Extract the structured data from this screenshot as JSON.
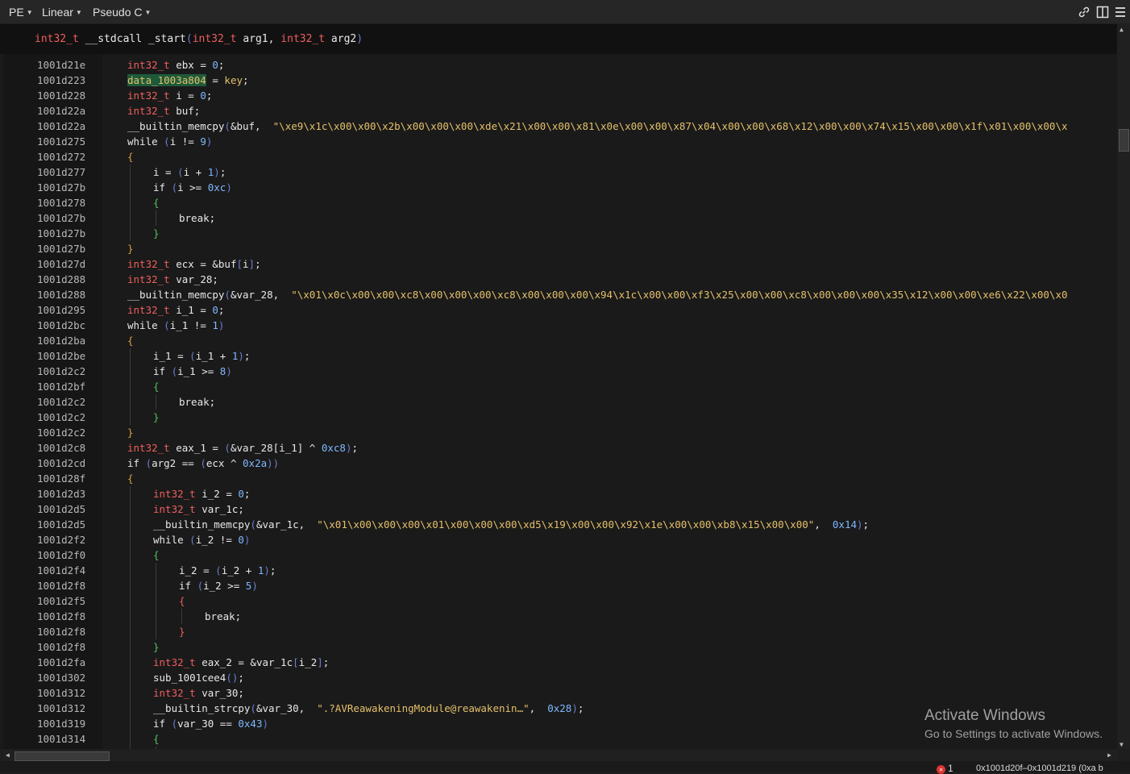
{
  "toolbar": {
    "view_type": "PE",
    "layout": "Linear",
    "language": "Pseudo C"
  },
  "icons": {
    "link": "link-icon",
    "split": "split-view-icon",
    "menu": "menu-icon"
  },
  "signature": {
    "ret_type": "int32_t",
    "conv": "__stdcall",
    "name": "_start",
    "arg_type1": "int32_t",
    "arg1": "arg1",
    "arg_type2": "int32_t",
    "arg2": "arg2"
  },
  "lines": [
    {
      "addr": "1001d21e",
      "indent": 0,
      "tokens": [
        [
          "ty",
          "int32_t"
        ],
        [
          "fn",
          " ebx = "
        ],
        [
          "nm",
          "0"
        ],
        [
          "fn",
          ";"
        ]
      ]
    },
    {
      "addr": "1001d223",
      "indent": 0,
      "tokens": [
        [
          "hl",
          "data_1003a804"
        ],
        [
          "fn",
          " = "
        ],
        [
          "key",
          "key"
        ],
        [
          "fn",
          ";"
        ]
      ]
    },
    {
      "addr": "1001d228",
      "indent": 0,
      "tokens": [
        [
          "ty",
          "int32_t"
        ],
        [
          "fn",
          " i = "
        ],
        [
          "nm",
          "0"
        ],
        [
          "fn",
          ";"
        ]
      ]
    },
    {
      "addr": "1001d22a",
      "indent": 0,
      "tokens": [
        [
          "ty",
          "int32_t"
        ],
        [
          "fn",
          " buf;"
        ]
      ]
    },
    {
      "addr": "1001d22a",
      "indent": 0,
      "tokens": [
        [
          "fn",
          "__builtin_memcpy"
        ],
        [
          "pa",
          "("
        ],
        [
          "fn",
          "&buf,  "
        ],
        [
          "st",
          "\"\\xe9\\x1c\\x00\\x00\\x2b\\x00\\x00\\x00\\xde\\x21\\x00\\x00\\x81\\x0e\\x00\\x00\\x87\\x04\\x00\\x00\\x68\\x12\\x00\\x00\\x74\\x15\\x00\\x00\\x1f\\x01\\x00\\x00\\x"
        ]
      ]
    },
    {
      "addr": "1001d275",
      "indent": 0,
      "tokens": [
        [
          "kw",
          "while "
        ],
        [
          "pa",
          "("
        ],
        [
          "fn",
          "i != "
        ],
        [
          "nm",
          "9"
        ],
        [
          "pa",
          ")"
        ]
      ]
    },
    {
      "addr": "1001d272",
      "indent": 0,
      "tokens": [
        [
          "br",
          "{"
        ]
      ]
    },
    {
      "addr": "1001d277",
      "indent": 1,
      "tokens": [
        [
          "fn",
          "i = "
        ],
        [
          "pa",
          "("
        ],
        [
          "fn",
          "i + "
        ],
        [
          "nm",
          "1"
        ],
        [
          "pa",
          ")"
        ],
        [
          "fn",
          ";"
        ]
      ]
    },
    {
      "addr": "1001d27b",
      "indent": 1,
      "tokens": [
        [
          "kw",
          "if "
        ],
        [
          "pa",
          "("
        ],
        [
          "fn",
          "i >= "
        ],
        [
          "nm",
          "0xc"
        ],
        [
          "pa",
          ")"
        ]
      ]
    },
    {
      "addr": "1001d278",
      "indent": 1,
      "tokens": [
        [
          "brg",
          "{"
        ]
      ]
    },
    {
      "addr": "1001d27b",
      "indent": 2,
      "tokens": [
        [
          "kw",
          "break;"
        ]
      ]
    },
    {
      "addr": "1001d27b",
      "indent": 1,
      "tokens": [
        [
          "brg",
          "}"
        ]
      ]
    },
    {
      "addr": "1001d27b",
      "indent": 0,
      "tokens": [
        [
          "br",
          "}"
        ]
      ]
    },
    {
      "addr": "1001d27d",
      "indent": 0,
      "tokens": [
        [
          "ty",
          "int32_t"
        ],
        [
          "fn",
          " ecx = &buf"
        ],
        [
          "pa",
          "["
        ],
        [
          "fn",
          "i"
        ],
        [
          "pa",
          "]"
        ],
        [
          "fn",
          ";"
        ]
      ]
    },
    {
      "addr": "1001d288",
      "indent": 0,
      "tokens": [
        [
          "ty",
          "int32_t"
        ],
        [
          "fn",
          " var_28;"
        ]
      ]
    },
    {
      "addr": "1001d288",
      "indent": 0,
      "tokens": [
        [
          "fn",
          "__builtin_memcpy"
        ],
        [
          "pa",
          "("
        ],
        [
          "fn",
          "&var_28,  "
        ],
        [
          "st",
          "\"\\x01\\x0c\\x00\\x00\\xc8\\x00\\x00\\x00\\xc8\\x00\\x00\\x00\\x94\\x1c\\x00\\x00\\xf3\\x25\\x00\\x00\\xc8\\x00\\x00\\x00\\x35\\x12\\x00\\x00\\xe6\\x22\\x00\\x0"
        ]
      ]
    },
    {
      "addr": "1001d295",
      "indent": 0,
      "tokens": [
        [
          "ty",
          "int32_t"
        ],
        [
          "fn",
          " i_1 = "
        ],
        [
          "nm",
          "0"
        ],
        [
          "fn",
          ";"
        ]
      ]
    },
    {
      "addr": "1001d2bc",
      "indent": 0,
      "tokens": [
        [
          "kw",
          "while "
        ],
        [
          "pa",
          "("
        ],
        [
          "fn",
          "i_1 != "
        ],
        [
          "nm",
          "1"
        ],
        [
          "pa",
          ")"
        ]
      ]
    },
    {
      "addr": "1001d2ba",
      "indent": 0,
      "tokens": [
        [
          "br",
          "{"
        ]
      ]
    },
    {
      "addr": "1001d2be",
      "indent": 1,
      "tokens": [
        [
          "fn",
          "i_1 = "
        ],
        [
          "pa",
          "("
        ],
        [
          "fn",
          "i_1 + "
        ],
        [
          "nm",
          "1"
        ],
        [
          "pa",
          ")"
        ],
        [
          "fn",
          ";"
        ]
      ]
    },
    {
      "addr": "1001d2c2",
      "indent": 1,
      "tokens": [
        [
          "kw",
          "if "
        ],
        [
          "pa",
          "("
        ],
        [
          "fn",
          "i_1 >= "
        ],
        [
          "nm",
          "8"
        ],
        [
          "pa",
          ")"
        ]
      ]
    },
    {
      "addr": "1001d2bf",
      "indent": 1,
      "tokens": [
        [
          "brg",
          "{"
        ]
      ]
    },
    {
      "addr": "1001d2c2",
      "indent": 2,
      "tokens": [
        [
          "kw",
          "break;"
        ]
      ]
    },
    {
      "addr": "1001d2c2",
      "indent": 1,
      "tokens": [
        [
          "brg",
          "}"
        ]
      ]
    },
    {
      "addr": "1001d2c2",
      "indent": 0,
      "tokens": [
        [
          "br",
          "}"
        ]
      ]
    },
    {
      "addr": "1001d2c8",
      "indent": 0,
      "tokens": [
        [
          "ty",
          "int32_t"
        ],
        [
          "fn",
          " eax_1 = "
        ],
        [
          "pa",
          "("
        ],
        [
          "fn",
          "&var_28[i_1] ^ "
        ],
        [
          "nm",
          "0xc8"
        ],
        [
          "pa",
          ")"
        ],
        [
          "fn",
          ";"
        ]
      ]
    },
    {
      "addr": "1001d2cd",
      "indent": 0,
      "tokens": [
        [
          "kw",
          "if "
        ],
        [
          "pa",
          "("
        ],
        [
          "fn",
          "arg2 == "
        ],
        [
          "pa",
          "("
        ],
        [
          "fn",
          "ecx ^ "
        ],
        [
          "nm",
          "0x2a"
        ],
        [
          "pa",
          "))"
        ]
      ]
    },
    {
      "addr": "1001d28f",
      "indent": 0,
      "tokens": [
        [
          "br",
          "{"
        ]
      ]
    },
    {
      "addr": "1001d2d3",
      "indent": 1,
      "tokens": [
        [
          "ty",
          "int32_t"
        ],
        [
          "fn",
          " i_2 = "
        ],
        [
          "nm",
          "0"
        ],
        [
          "fn",
          ";"
        ]
      ]
    },
    {
      "addr": "1001d2d5",
      "indent": 1,
      "tokens": [
        [
          "ty",
          "int32_t"
        ],
        [
          "fn",
          " var_1c;"
        ]
      ]
    },
    {
      "addr": "1001d2d5",
      "indent": 1,
      "tokens": [
        [
          "fn",
          "__builtin_memcpy"
        ],
        [
          "pa",
          "("
        ],
        [
          "fn",
          "&var_1c,  "
        ],
        [
          "st",
          "\"\\x01\\x00\\x00\\x00\\x01\\x00\\x00\\x00\\xd5\\x19\\x00\\x00\\x92\\x1e\\x00\\x00\\xb8\\x15\\x00\\x00\""
        ],
        [
          "fn",
          ",  "
        ],
        [
          "nm",
          "0x14"
        ],
        [
          "pa",
          ")"
        ],
        [
          "fn",
          ";"
        ]
      ]
    },
    {
      "addr": "1001d2f2",
      "indent": 1,
      "tokens": [
        [
          "kw",
          "while "
        ],
        [
          "pa",
          "("
        ],
        [
          "fn",
          "i_2 != "
        ],
        [
          "nm",
          "0"
        ],
        [
          "pa",
          ")"
        ]
      ]
    },
    {
      "addr": "1001d2f0",
      "indent": 1,
      "tokens": [
        [
          "brg",
          "{"
        ]
      ]
    },
    {
      "addr": "1001d2f4",
      "indent": 2,
      "tokens": [
        [
          "fn",
          "i_2 = "
        ],
        [
          "pa",
          "("
        ],
        [
          "fn",
          "i_2 + "
        ],
        [
          "nm",
          "1"
        ],
        [
          "pa",
          ")"
        ],
        [
          "fn",
          ";"
        ]
      ]
    },
    {
      "addr": "1001d2f8",
      "indent": 2,
      "tokens": [
        [
          "kw",
          "if "
        ],
        [
          "pa",
          "("
        ],
        [
          "fn",
          "i_2 >= "
        ],
        [
          "nm",
          "5"
        ],
        [
          "pa",
          ")"
        ]
      ]
    },
    {
      "addr": "1001d2f5",
      "indent": 2,
      "tokens": [
        [
          "ty",
          "{"
        ]
      ]
    },
    {
      "addr": "1001d2f8",
      "indent": 3,
      "tokens": [
        [
          "kw",
          "break;"
        ]
      ]
    },
    {
      "addr": "1001d2f8",
      "indent": 2,
      "tokens": [
        [
          "ty",
          "}"
        ]
      ]
    },
    {
      "addr": "1001d2f8",
      "indent": 1,
      "tokens": [
        [
          "brg",
          "}"
        ]
      ]
    },
    {
      "addr": "1001d2fa",
      "indent": 1,
      "tokens": [
        [
          "ty",
          "int32_t"
        ],
        [
          "fn",
          " eax_2 = &var_1c"
        ],
        [
          "pa",
          "["
        ],
        [
          "fn",
          "i_2"
        ],
        [
          "pa",
          "]"
        ],
        [
          "fn",
          ";"
        ]
      ]
    },
    {
      "addr": "1001d302",
      "indent": 1,
      "tokens": [
        [
          "fn",
          "sub_1001cee4"
        ],
        [
          "pa",
          "()"
        ],
        [
          "fn",
          ";"
        ]
      ]
    },
    {
      "addr": "1001d312",
      "indent": 1,
      "tokens": [
        [
          "ty",
          "int32_t"
        ],
        [
          "fn",
          " var_30;"
        ]
      ]
    },
    {
      "addr": "1001d312",
      "indent": 1,
      "tokens": [
        [
          "fn",
          "__builtin_strcpy"
        ],
        [
          "pa",
          "("
        ],
        [
          "fn",
          "&var_30,  "
        ],
        [
          "st",
          "\".?AVReawakeningModule@reawakenin…\""
        ],
        [
          "fn",
          ",  "
        ],
        [
          "nm",
          "0x28"
        ],
        [
          "pa",
          ")"
        ],
        [
          "fn",
          ";"
        ]
      ]
    },
    {
      "addr": "1001d319",
      "indent": 1,
      "tokens": [
        [
          "kw",
          "if "
        ],
        [
          "pa",
          "("
        ],
        [
          "fn",
          "var_30 == "
        ],
        [
          "nm",
          "0x43"
        ],
        [
          "pa",
          ")"
        ]
      ]
    },
    {
      "addr": "1001d314",
      "indent": 1,
      "tokens": [
        [
          "brg",
          "{"
        ]
      ]
    }
  ],
  "status": {
    "error_count": "1",
    "range": "0x1001d20f–0x1001d219 (0xa b"
  },
  "watermark": {
    "line1": "Activate Windows",
    "line2": "Go to Settings to activate Windows."
  },
  "colors": {
    "type": "#ef5e5e",
    "number": "#7fb8ff",
    "string": "#e5c06a",
    "paren": "#6a7fd0",
    "brace_outer": "#d9a040",
    "brace_inner": "#55c060"
  }
}
